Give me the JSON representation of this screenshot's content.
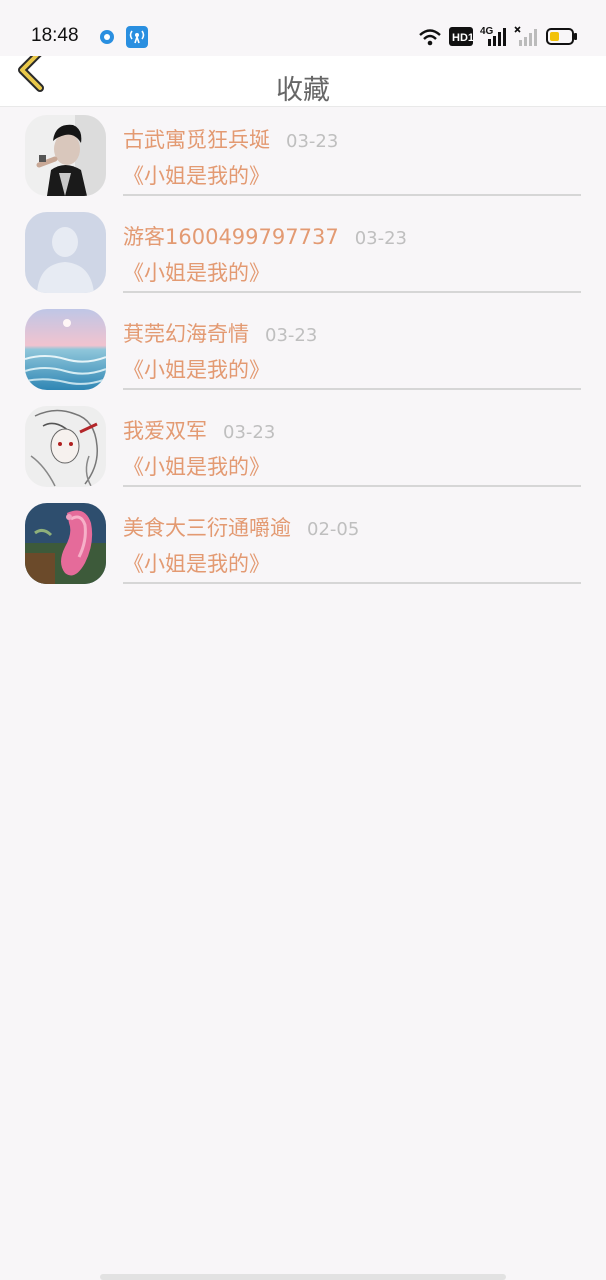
{
  "status_bar": {
    "time": "18:48",
    "icons": [
      "record-dot-icon",
      "hotspot-icon",
      "wifi-icon",
      "hd-badge-icon",
      "signal-4g-icon",
      "signal-off-icon",
      "battery-icon"
    ],
    "hd_label": "HD1",
    "network_label": "4G"
  },
  "header": {
    "title": "收藏",
    "back_icon": "chevron-left-icon"
  },
  "favorites": [
    {
      "name": "古武寓觅狂兵埏",
      "date": "03-23",
      "book": "《小姐是我的》",
      "avatar": "photo-man-black-white"
    },
    {
      "name": "游客1600499797737",
      "date": "03-23",
      "book": "《小姐是我的》",
      "avatar": "default-silhouette"
    },
    {
      "name": "萁莞幻海奇情",
      "date": "03-23",
      "book": "《小姐是我的》",
      "avatar": "ocean-sunset"
    },
    {
      "name": "我爱双军",
      "date": "03-23",
      "book": "《小姐是我的》",
      "avatar": "anime-sketch"
    },
    {
      "name": "美食大三衍通嚼逾",
      "date": "02-05",
      "book": "《小姐是我的》",
      "avatar": "pink-swan-craft"
    }
  ],
  "colors": {
    "accent": "#e39a72",
    "date": "#bfbfbf",
    "title": "#666666",
    "back": "#e9c84a"
  }
}
